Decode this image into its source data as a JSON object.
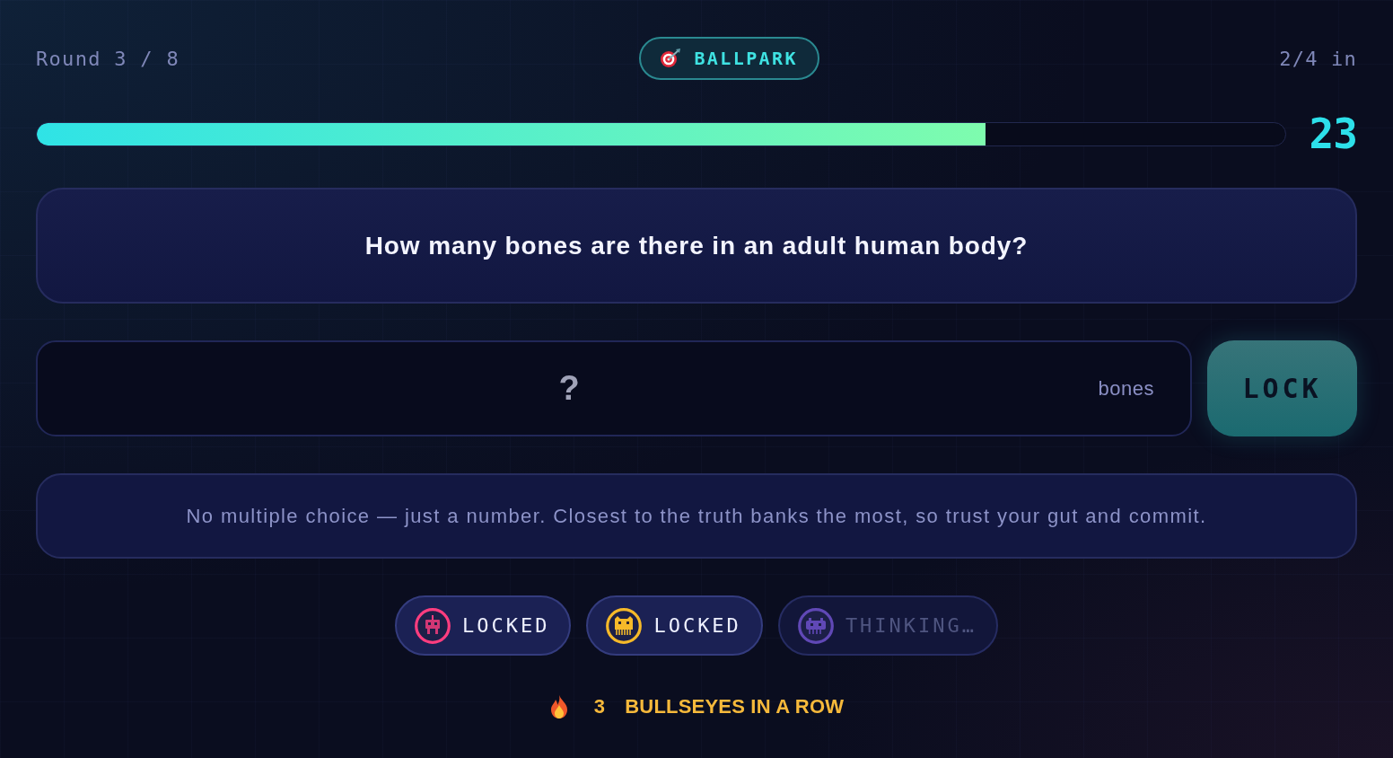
{
  "header": {
    "round": "Round 3 / 8",
    "mode": "BALLPARK",
    "progress": "2/4 in"
  },
  "timer": {
    "level": 0.76,
    "reading": "23"
  },
  "question": "How many bones are there in an adult human body?",
  "answer": {
    "placeholder": "?",
    "unit": "bones",
    "button": "LOCK"
  },
  "hint": "No multiple choice — just a number. Closest to the truth banks the most, so trust your gut and commit.",
  "players": [
    {
      "kind": "robot",
      "color": "#ff3d7f",
      "status": "LOCKED",
      "locked": true
    },
    {
      "kind": "cat",
      "color": "#f6b929",
      "status": "LOCKED",
      "locked": true
    },
    {
      "kind": "alien",
      "color": "#6048b6",
      "status": "THINKING…",
      "locked": false
    }
  ],
  "streak": {
    "count": "3",
    "label": "BULLSEYES IN A ROW"
  }
}
